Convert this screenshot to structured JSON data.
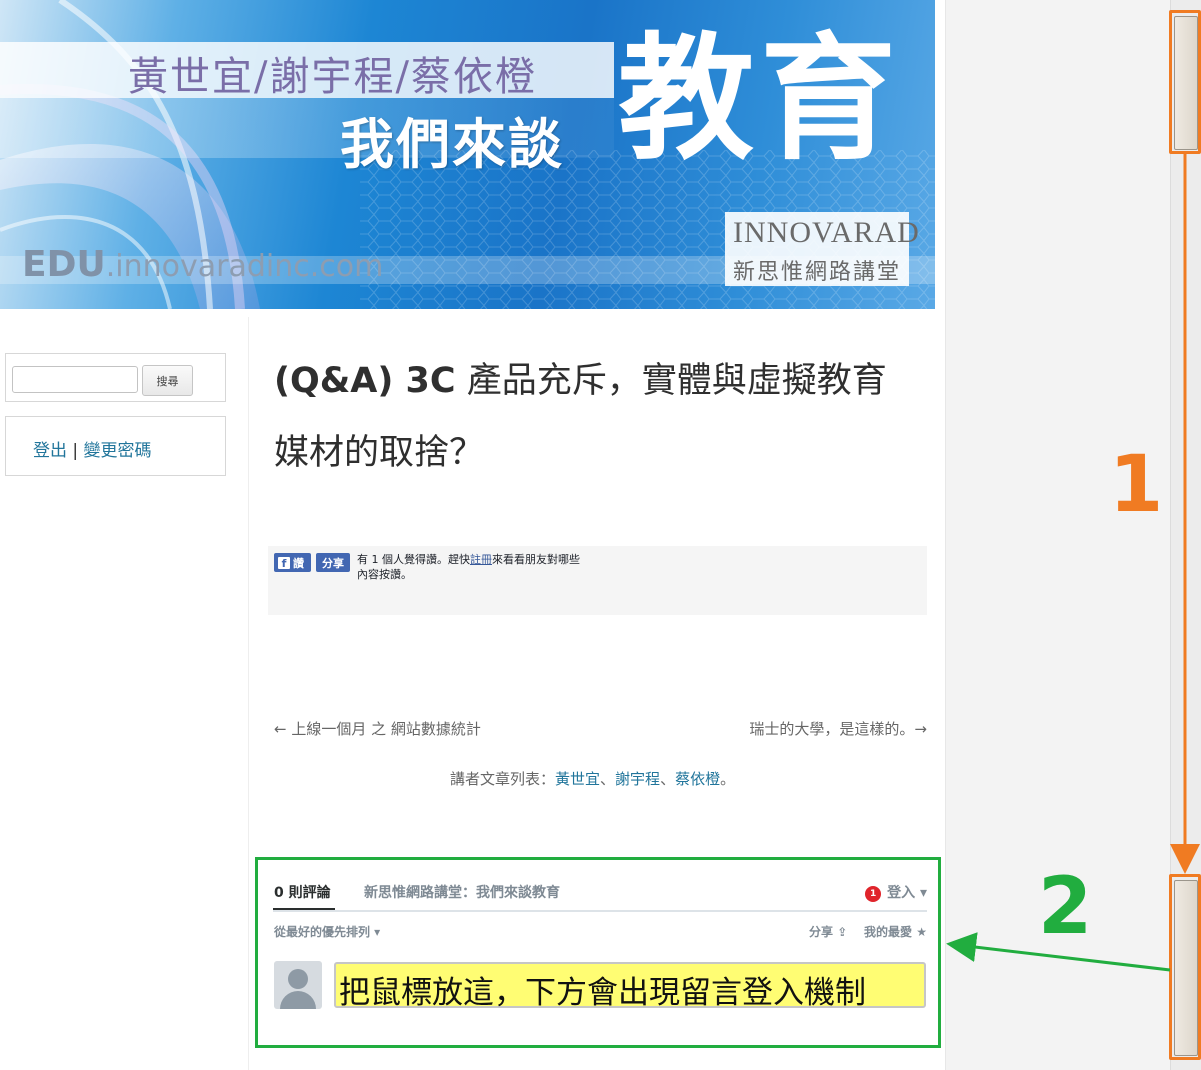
{
  "banner": {
    "names": "黃世宜/謝宇程/蔡依橙",
    "subtitle": "我們來談",
    "big_title": "教育",
    "url_prefix": "EDU",
    "url_rest": ".innovaradinc.com",
    "logo_top": "INNOVARAD",
    "logo_bottom": "新思惟網路講堂"
  },
  "sidebar": {
    "search_placeholder": "",
    "search_button": "搜尋",
    "logout_link": "登出",
    "separator": "|",
    "change_password_link": "變更密碼"
  },
  "post": {
    "title_en": "(Q&A) 3C",
    "title_zh": " 產品充斥，實體與虛擬教育媒材的取捨？"
  },
  "facebook": {
    "like_label": "讚",
    "share_label": "分享",
    "text_before": "有 1 個人覺得讚。趕快",
    "text_link": "註冊",
    "text_after": "來看看朋友對哪些內容按讚。"
  },
  "post_nav": {
    "prev": "← 上線一個月 之 網站數據統計",
    "next": "瑞士的大學，是這樣的。→"
  },
  "authors": {
    "prefix": "講者文章列表：",
    "author1": "黃世宜",
    "sep1": "、",
    "author2": "謝宇程",
    "sep2": "、",
    "author3": "蔡依橙",
    "suffix": "。"
  },
  "disqus": {
    "comment_count": "0 則評論",
    "forum_name": "新思惟網路講堂：我們來談教育",
    "badge_count": "1",
    "login_label": "登入 ▾",
    "sort_label": "從最好的優先排列 ▾",
    "share_label": "分享",
    "favorite_label": "我的最愛",
    "input_text": "把鼠標放這，下方會出現留言登入機制"
  },
  "annotations": {
    "label_1": "1",
    "label_2": "2",
    "orange": "#f07b22",
    "green": "#21ad3f"
  },
  "colors": {
    "link": "#21759b",
    "facebook_blue": "#4267b2",
    "highlight": "#fffd73"
  }
}
